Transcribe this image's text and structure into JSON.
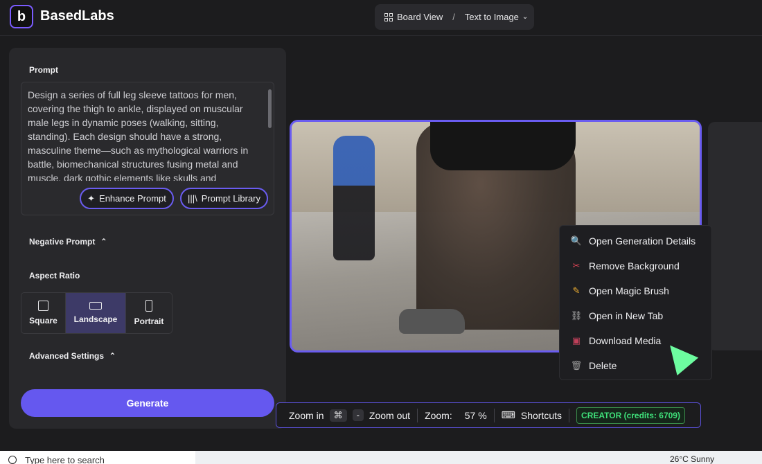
{
  "app": {
    "brand": "BasedLabs",
    "logo_letter": "b"
  },
  "breadcrumb": {
    "board": "Board View",
    "separator": "/",
    "current": "Text to Image"
  },
  "prompt": {
    "label": "Prompt",
    "text": "Design a series of full leg sleeve tattoos for men, covering the thigh to ankle, displayed on muscular male legs in dynamic poses (walking, sitting, standing). Each design should have a strong, masculine theme—such as mythological warriors in battle, biomechanical structures fusing metal and muscle, dark gothic elements like skulls and",
    "enhance_label": "Enhance Prompt",
    "library_label": "Prompt Library"
  },
  "negative_prompt": {
    "label": "Negative Prompt"
  },
  "aspect": {
    "label": "Aspect Ratio",
    "options": [
      {
        "label": "Square",
        "active": false
      },
      {
        "label": "Landscape",
        "active": true
      },
      {
        "label": "Portrait",
        "active": false
      }
    ]
  },
  "advanced": {
    "label": "Advanced Settings"
  },
  "generate_label": "Generate",
  "context_menu": {
    "items": [
      {
        "label": "Open Generation Details",
        "icon": "magnifier-icon"
      },
      {
        "label": "Remove Background",
        "icon": "scissors-icon"
      },
      {
        "label": "Open Magic Brush",
        "icon": "pencil-icon"
      },
      {
        "label": "Open in New Tab",
        "icon": "link-icon"
      },
      {
        "label": "Download Media",
        "icon": "floppy-icon"
      },
      {
        "label": "Delete",
        "icon": "trash-icon"
      }
    ]
  },
  "toolbar": {
    "zoom_in": "Zoom in",
    "cmd_key": "⌘",
    "minus_key": "-",
    "zoom_out": "Zoom out",
    "zoom_label": "Zoom:",
    "zoom_value": "57 %",
    "shortcuts": "Shortcuts",
    "plan_badge": "CREATOR (credits: 6709)"
  },
  "taskbar": {
    "search_placeholder": "Type here to search",
    "weather": "26°C  Sunny"
  },
  "colors": {
    "accent": "#6558ef",
    "badge_green": "#3fe07a",
    "cursor": "#6dfca0"
  }
}
